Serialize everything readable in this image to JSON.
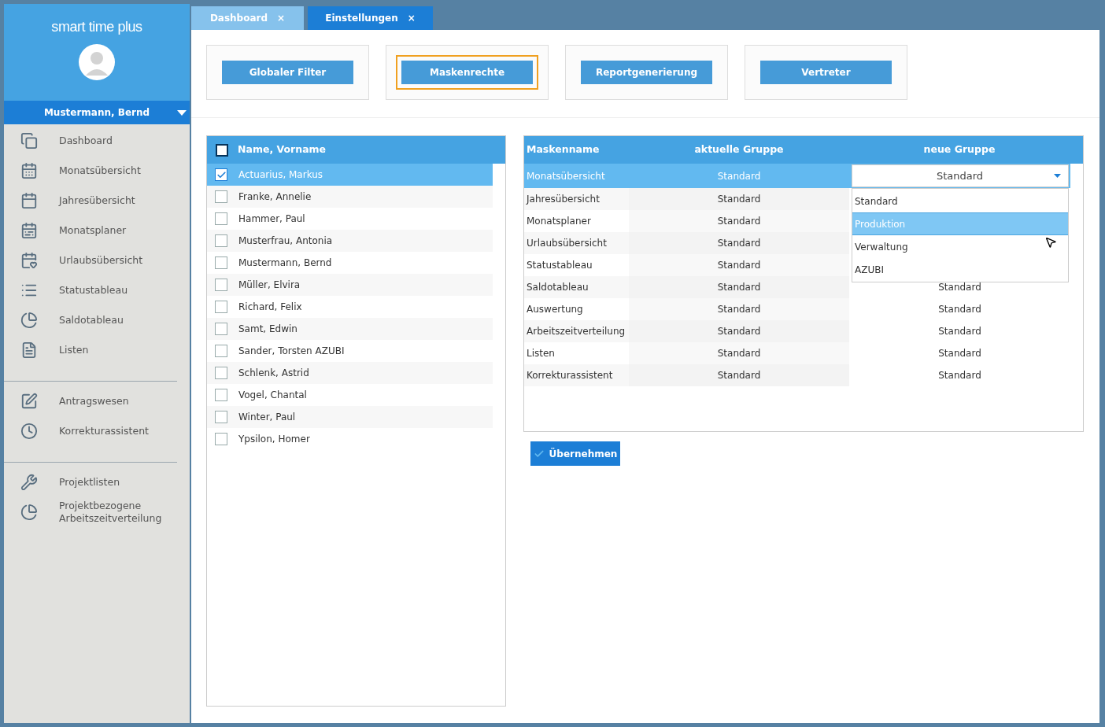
{
  "sidebar": {
    "app_title": "smart time plus",
    "user": "Mustermann, Bernd",
    "groups": [
      [
        {
          "label": "Dashboard"
        },
        {
          "label": "Monatsübersicht"
        },
        {
          "label": "Jahresübersicht"
        },
        {
          "label": "Monatsplaner"
        },
        {
          "label": "Urlaubsübersicht"
        },
        {
          "label": "Statustableau"
        },
        {
          "label": "Saldotableau"
        },
        {
          "label": "Listen"
        }
      ],
      [
        {
          "label": "Antragswesen"
        },
        {
          "label": "Korrekturassistent"
        }
      ],
      [
        {
          "label": "Projektlisten"
        },
        {
          "label": "Projektbezogene Arbeitszeitverteilung"
        }
      ]
    ]
  },
  "tabs": [
    {
      "label": "Dashboard",
      "close": "×",
      "selected": false
    },
    {
      "label": "Einstellungen",
      "close": "×",
      "selected": true
    }
  ],
  "settings_buttons": [
    {
      "label": "Globaler Filter",
      "selected": false
    },
    {
      "label": "Maskenrechte",
      "selected": true
    },
    {
      "label": "Reportgenerierung",
      "selected": false
    },
    {
      "label": "Vertreter",
      "selected": false
    }
  ],
  "people": {
    "header": "Name, Vorname",
    "all_checked": false,
    "rows": [
      {
        "name": "Actuarius, Markus",
        "checked": true
      },
      {
        "name": "Franke, Annelie",
        "checked": false
      },
      {
        "name": "Hammer, Paul",
        "checked": false
      },
      {
        "name": "Musterfrau, Antonia",
        "checked": false
      },
      {
        "name": "Mustermann, Bernd",
        "checked": false
      },
      {
        "name": "Müller, Elvira",
        "checked": false
      },
      {
        "name": "Richard, Felix",
        "checked": false
      },
      {
        "name": "Samt, Edwin",
        "checked": false
      },
      {
        "name": "Sander, Torsten AZUBI",
        "checked": false
      },
      {
        "name": "Schlenk, Astrid",
        "checked": false
      },
      {
        "name": "Vogel, Chantal",
        "checked": false
      },
      {
        "name": "Winter, Paul",
        "checked": false
      },
      {
        "name": "Ypsilon, Homer",
        "checked": false
      }
    ]
  },
  "masks": {
    "columns": [
      "Maskenname",
      "aktuelle Gruppe",
      "neue Gruppe"
    ],
    "rows": [
      {
        "name": "Monatsübersicht",
        "current": "Standard",
        "new": "Standard",
        "selected": true
      },
      {
        "name": "Jahresübersicht",
        "current": "Standard",
        "selected": false
      },
      {
        "name": "Monatsplaner",
        "current": "Standard",
        "selected": false
      },
      {
        "name": "Urlaubsübersicht",
        "current": "Standard",
        "selected": false
      },
      {
        "name": "Statustableau",
        "current": "Standard",
        "selected": false
      },
      {
        "name": "Saldotableau",
        "current": "Standard",
        "new": "Standard",
        "selected": false
      },
      {
        "name": "Auswertung",
        "current": "Standard",
        "new": "Standard",
        "selected": false
      },
      {
        "name": "Arbeitszeitverteilung",
        "current": "Standard",
        "new": "Standard",
        "selected": false
      },
      {
        "name": "Listen",
        "current": "Standard",
        "new": "Standard",
        "selected": false
      },
      {
        "name": "Korrekturassistent",
        "current": "Standard",
        "new": "Standard",
        "selected": false
      }
    ],
    "dropdown_options": [
      {
        "label": "Standard",
        "selected": false
      },
      {
        "label": "Produktion",
        "selected": true
      },
      {
        "label": "Verwaltung",
        "selected": false
      },
      {
        "label": "AZUBI",
        "selected": false
      }
    ]
  },
  "apply_button": "Übernehmen"
}
